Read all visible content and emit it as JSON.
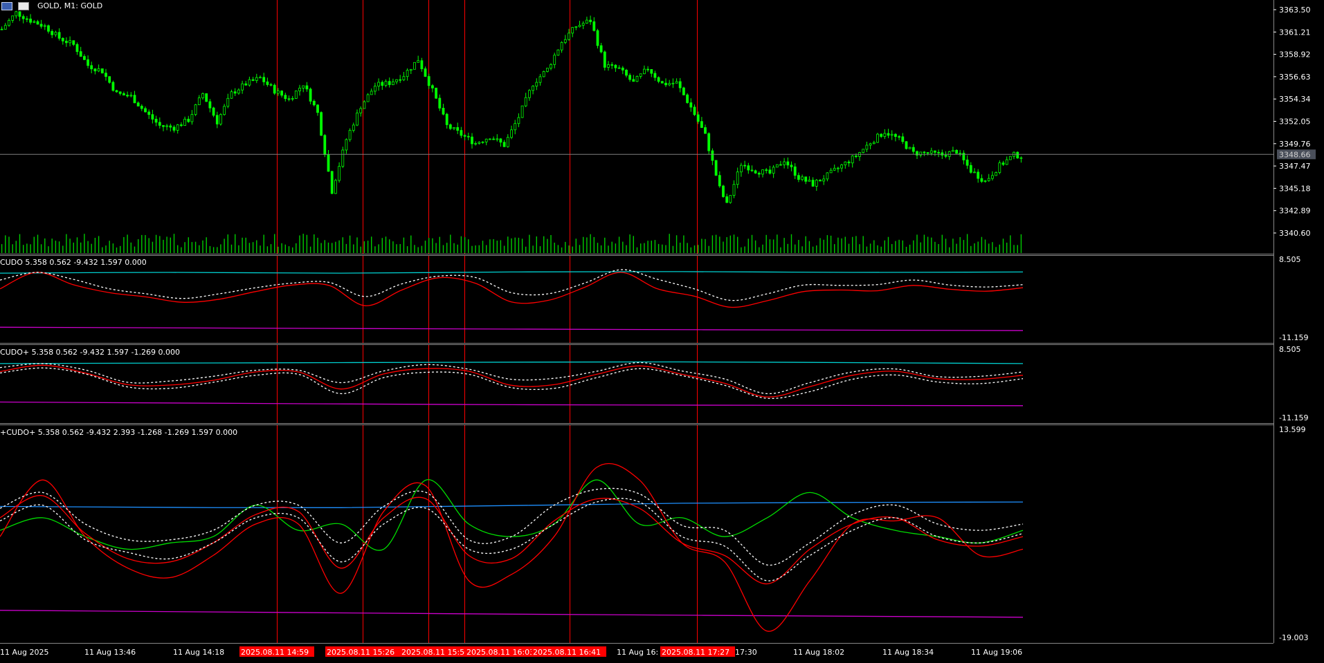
{
  "window": {
    "title": "GOLD, M1:  GOLD",
    "icons": [
      "chart-menu-icon",
      "one-click-trading-icon"
    ]
  },
  "colors": {
    "bg": "#000000",
    "candle_up": "#00ff00",
    "candle_down": "#00ff00",
    "volume": "#00cc00",
    "separator": "#888888",
    "price_line": "#808080",
    "red_line": "#ff0000",
    "cyan": "#00d0d0",
    "yellow": "#ffff00",
    "magenta": "#cc00cc",
    "white_dotted": "#ffffff",
    "blue": "#1e90ff",
    "green": "#00dd00",
    "axis_text": "#ffffff",
    "time_label_bg": "#ff0000",
    "price_label_bg": "#4a4f5a"
  },
  "price_axis": {
    "ticks": [
      "3363.50",
      "3361.21",
      "3358.92",
      "3356.63",
      "3354.34",
      "3352.05",
      "3349.76",
      "3347.47",
      "3345.18",
      "3342.89",
      "3340.60"
    ],
    "current_price": "3348.66"
  },
  "time_axis": {
    "labels": [
      "11 Aug 2025",
      "11 Aug 13:46",
      "11 Aug 14:18",
      "11 Aug 16:",
      "17:30",
      "11 Aug 18:02",
      "11 Aug 18:34",
      "11 Aug 19:06",
      "1"
    ],
    "highlighted": [
      "2025.08.11 14:59",
      "2025.08.11 15:26",
      "2025.08.11 15:50",
      "2025.08.11 16:03",
      "2025.08.11 16:41",
      "2025.08.11 17:27"
    ]
  },
  "panes": [
    {
      "name": "main",
      "ymax": "",
      "ymin": ""
    },
    {
      "name": "cudo",
      "label": "CUDO 5.358 0.562 -9.432 1.597 0.000",
      "ymax": "8.505",
      "ymin": "-11.159"
    },
    {
      "name": "cudo-plus",
      "label": "CUDO+ 5.358 0.562 -9.432 1.597 -1.269 0.000",
      "ymax": "8.505",
      "ymin": "-11.159"
    },
    {
      "name": "plus-cudo-plus",
      "label": "+CUDO+ 5.358 0.562 -9.432 2.393 -1.268 -1.269 1.597 0.000",
      "ymax": "13.599",
      "ymin": "-19.003"
    }
  ],
  "chart_data": [
    {
      "type": "candlestick",
      "symbol": "GOLD",
      "timeframe": "M1",
      "close_profile": [
        [
          0,
          3361.5
        ],
        [
          4,
          3363.2
        ],
        [
          8,
          3362.4
        ],
        [
          12,
          3361.8
        ],
        [
          16,
          3360.6
        ],
        [
          20,
          3359.9
        ],
        [
          24,
          3357.8
        ],
        [
          28,
          3357.2
        ],
        [
          32,
          3354.9
        ],
        [
          36,
          3354.6
        ],
        [
          40,
          3353.0
        ],
        [
          44,
          3351.6
        ],
        [
          48,
          3351.4
        ],
        [
          52,
          3352.2
        ],
        [
          56,
          3354.9
        ],
        [
          60,
          3352.0
        ],
        [
          64,
          3354.9
        ],
        [
          68,
          3355.9
        ],
        [
          72,
          3356.5
        ],
        [
          76,
          3355.2
        ],
        [
          80,
          3354.3
        ],
        [
          84,
          3355.9
        ],
        [
          88,
          3352.9
        ],
        [
          92,
          3344.9
        ],
        [
          96,
          3350.2
        ],
        [
          100,
          3353.6
        ],
        [
          104,
          3355.7
        ],
        [
          108,
          3356.0
        ],
        [
          112,
          3356.8
        ],
        [
          116,
          3358.4
        ],
        [
          118,
          3356.8
        ],
        [
          120,
          3355.2
        ],
        [
          124,
          3351.6
        ],
        [
          128,
          3350.7
        ],
        [
          132,
          3349.8
        ],
        [
          136,
          3350.5
        ],
        [
          140,
          3349.6
        ],
        [
          144,
          3352.5
        ],
        [
          148,
          3355.9
        ],
        [
          152,
          3357.4
        ],
        [
          156,
          3360.2
        ],
        [
          160,
          3361.8
        ],
        [
          164,
          3362.4
        ],
        [
          168,
          3357.8
        ],
        [
          172,
          3357.4
        ],
        [
          176,
          3356.0
        ],
        [
          180,
          3357.5
        ],
        [
          184,
          3355.9
        ],
        [
          188,
          3356.0
        ],
        [
          192,
          3353.5
        ],
        [
          196,
          3350.6
        ],
        [
          200,
          3345.2
        ],
        [
          202,
          3343.5
        ],
        [
          206,
          3347.7
        ],
        [
          210,
          3347.0
        ],
        [
          214,
          3346.7
        ],
        [
          218,
          3348.1
        ],
        [
          222,
          3346.3
        ],
        [
          226,
          3345.6
        ],
        [
          230,
          3346.5
        ],
        [
          234,
          3347.5
        ],
        [
          238,
          3348.5
        ],
        [
          242,
          3349.9
        ],
        [
          246,
          3351.0
        ],
        [
          250,
          3350.2
        ],
        [
          254,
          3348.8
        ],
        [
          258,
          3348.8
        ],
        [
          262,
          3348.6
        ],
        [
          266,
          3349.0
        ],
        [
          270,
          3347.0
        ],
        [
          274,
          3345.9
        ],
        [
          278,
          3347.5
        ],
        [
          282,
          3348.6
        ],
        [
          284,
          3348.5
        ]
      ],
      "volume": "present"
    },
    {
      "type": "line",
      "pane": "CUDO",
      "ylim": [
        -11.159,
        8.505
      ],
      "series": [
        {
          "color": "cyan",
          "levels": [
            5.6,
            5.8,
            5.6,
            5.9,
            6.0,
            5.8,
            5.9
          ]
        },
        {
          "color": "yellow",
          "levels": [
            1.0
          ]
        },
        {
          "color": "magenta",
          "levels": [
            -8.5,
            -9.0,
            -9.4
          ]
        },
        {
          "color": "red",
          "values": [
            1.5,
            5.8,
            2.6,
            0.5,
            -0.6,
            -2.0,
            -1.2,
            0.8,
            2.5,
            2.4,
            -2.9,
            1.2,
            4.4,
            3.0,
            -1.9,
            -1.5,
            1.9,
            5.8,
            1.5,
            -0.4,
            -3.3,
            -1.6,
            0.8,
            1.2,
            1.0,
            2.4,
            1.4,
            0.9,
            1.8
          ]
        },
        {
          "color": "white-dotted",
          "values": [
            3.8,
            5.8,
            4.0,
            1.5,
            0.2,
            -1.0,
            0.2,
            1.8,
            3.0,
            3.2,
            -0.5,
            2.8,
            4.8,
            4.5,
            0.5,
            0.2,
            3.0,
            6.5,
            4.0,
            1.5,
            -1.5,
            0.2,
            2.5,
            2.4,
            2.6,
            3.8,
            2.5,
            2.0,
            2.6
          ]
        }
      ]
    },
    {
      "type": "line",
      "pane": "CUDO+",
      "ylim": [
        -11.159,
        8.505
      ],
      "series": [
        {
          "color": "cyan",
          "levels": [
            5.0,
            5.3,
            5.5,
            5.0
          ]
        },
        {
          "color": "yellow",
          "levels": [
            1.6
          ]
        },
        {
          "color": "magenta",
          "levels": [
            -6.5,
            -7.3,
            -7.6
          ]
        },
        {
          "color": "red",
          "values": [
            2.6,
            4.5,
            2.2,
            -1.3,
            -1.4,
            0.0,
            2.5,
            2.5,
            -2.6,
            1.9,
            3.5,
            2.7,
            -1.5,
            -1.3,
            1.8,
            4.3,
            1.8,
            -0.9,
            -5.0,
            -1.9,
            1.5,
            2.7,
            0.5,
            0.3,
            1.5
          ]
        },
        {
          "color": "white-dotted",
          "values": [
            3.8,
            5.0,
            3.1,
            -0.6,
            -0.2,
            1.2,
            3.0,
            3.0,
            -0.7,
            2.8,
            4.7,
            3.3,
            0.3,
            0.6,
            2.7,
            5.3,
            2.8,
            0.4,
            -4.0,
            -0.7,
            2.5,
            3.4,
            1.1,
            1.2,
            2.5
          ]
        },
        {
          "color": "white-dotted",
          "values": [
            2.2,
            3.7,
            1.9,
            -2.0,
            -2.4,
            -0.6,
            1.5,
            1.8,
            -4.0,
            0.8,
            2.4,
            1.8,
            -2.2,
            -2.4,
            0.8,
            3.5,
            1.4,
            -1.5,
            -5.4,
            -3.4,
            0.3,
            1.6,
            -0.5,
            -1.0,
            0.5
          ]
        }
      ]
    },
    {
      "type": "line",
      "pane": "+CUDO+",
      "ylim": [
        -19.003,
        13.599
      ],
      "series": [
        {
          "color": "blue",
          "levels": [
            1.8,
            1.6,
            2.3,
            2.5
          ]
        },
        {
          "color": "yellow",
          "levels": [
            -4.0
          ]
        },
        {
          "color": "magenta",
          "levels": [
            -14.7,
            -15.3,
            -15.8
          ]
        },
        {
          "color": "green",
          "values": [
            -2.0,
            0.0,
            -3.0,
            -5.0,
            -4.0,
            -3.0,
            2.0,
            -2.0,
            -1.0,
            -5.0,
            6.0,
            -1.0,
            -3.0,
            -1.0,
            6.0,
            -1.0,
            0.0,
            -3.0,
            0.0,
            4.0,
            0.0,
            -2.0,
            -3.0,
            -4.0,
            -2.0
          ]
        },
        {
          "color": "red",
          "values": [
            -3.0,
            6.0,
            -3.0,
            -8.0,
            -9.5,
            -6.0,
            -1.0,
            -1.0,
            -12.0,
            1.0,
            5.0,
            -10.0,
            -9.0,
            -3.0,
            8.0,
            6.0,
            -4.0,
            -7.0,
            -18.0,
            -10.0,
            -1.0,
            -0.5,
            0.0,
            -6.0,
            -5.0
          ]
        },
        {
          "color": "red",
          "values": [
            0.0,
            3.5,
            -2.5,
            -6.5,
            -7.0,
            -4.0,
            0.5,
            1.0,
            -8.0,
            0.0,
            3.0,
            -6.0,
            -6.5,
            -0.5,
            3.0,
            1.5,
            -4.0,
            -6.0,
            -10.5,
            -5.0,
            -1.0,
            0.0,
            -3.5,
            -4.5,
            -3.0
          ]
        },
        {
          "color": "white-dotted",
          "values": [
            1.5,
            4.0,
            -1.0,
            -3.5,
            -3.5,
            -2.0,
            2.0,
            2.0,
            -4.0,
            1.8,
            4.0,
            -3.5,
            -3.0,
            2.0,
            4.5,
            3.8,
            -1.2,
            -2.0,
            -7.5,
            -4.0,
            0.5,
            2.0,
            -1.0,
            -2.0,
            -1.0
          ]
        },
        {
          "color": "white-dotted",
          "values": [
            -0.5,
            2.0,
            -3.5,
            -5.5,
            -6.5,
            -4.0,
            0.0,
            0.0,
            -7.0,
            -1.0,
            1.5,
            -5.0,
            -5.0,
            -1.0,
            2.5,
            2.5,
            -3.0,
            -4.5,
            -10.0,
            -6.0,
            -2.0,
            0.0,
            -3.0,
            -4.0,
            -2.5
          ]
        }
      ]
    }
  ]
}
